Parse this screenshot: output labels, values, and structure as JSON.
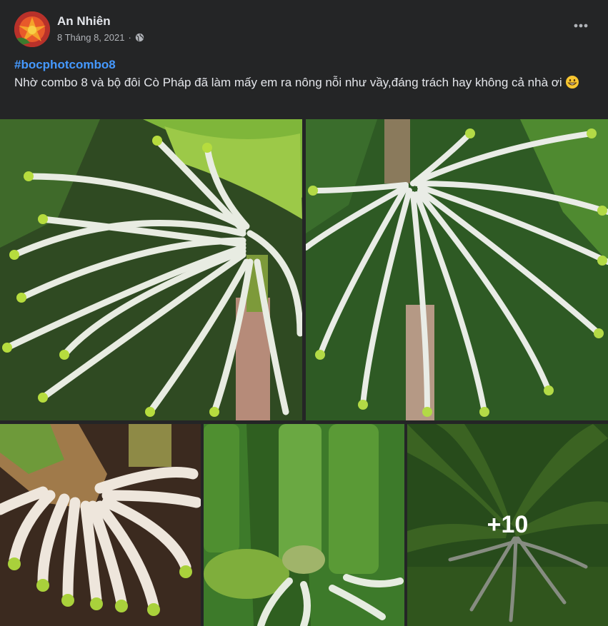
{
  "post": {
    "author": "An Nhiên",
    "date": "8 Tháng 8, 2021",
    "hashtag": "#bocphotcombo8",
    "body": "Nhờ combo 8 và bộ đôi Cò Pháp đã làm mấy em ra nông nỗi như vầy,đáng trách hay không cả nhà ơi",
    "more_photos_label": "+10"
  },
  "icons": {
    "privacy": "globe-icon",
    "options": "more-horizontal-icon",
    "emoji": "grinning-face-emoji"
  },
  "colors": {
    "background": "#242526",
    "text": "#e4e6eb",
    "secondary_text": "#b0b3b8",
    "hashtag": "#4599ff"
  }
}
